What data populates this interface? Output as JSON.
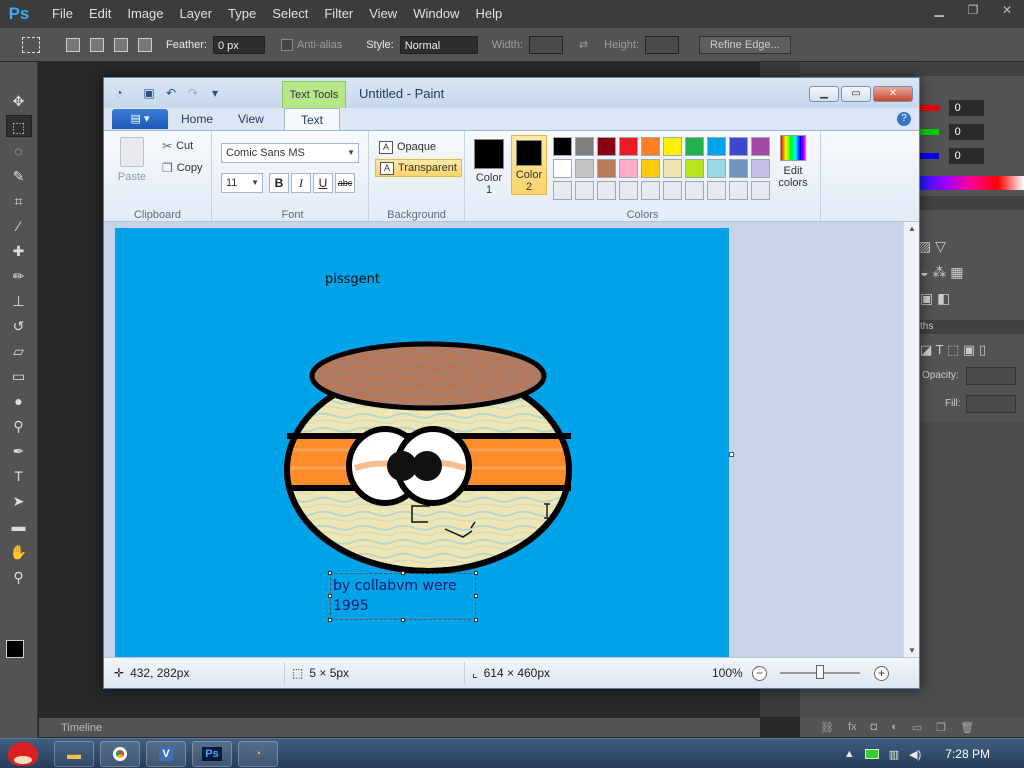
{
  "photoshop": {
    "logo": "Ps",
    "menu": [
      "File",
      "Edit",
      "Image",
      "Layer",
      "Type",
      "Select",
      "Filter",
      "View",
      "Window",
      "Help"
    ],
    "options": {
      "feather_label": "Feather:",
      "feather_value": "0 px",
      "antialias_label": "Anti-alias",
      "style_label": "Style:",
      "style_value": "Normal",
      "width_label": "Width:",
      "height_label": "Height:",
      "refine_edge": "Refine Edge..."
    },
    "color_panel": {
      "r": "0",
      "g": "0",
      "b": "0"
    },
    "panel_labels": {
      "paths": "ths",
      "opacity": "Opacity:",
      "fill": "Fill:"
    },
    "timeline": "Timeline"
  },
  "paint": {
    "context_tab": "Text Tools",
    "title": "Untitled - Paint",
    "tabs": [
      "Home",
      "View",
      "Text"
    ],
    "active_tab": "Text",
    "clipboard": {
      "paste": "Paste",
      "cut": "Cut",
      "copy": "Copy",
      "group": "Clipboard"
    },
    "font": {
      "family": "Comic Sans MS",
      "size": "11",
      "bold": "B",
      "italic": "I",
      "underline": "U",
      "strike": "abc",
      "group": "Font"
    },
    "background": {
      "opaque": "Opaque",
      "transparent": "Transparent",
      "group": "Background",
      "selected": "Transparent"
    },
    "colors": {
      "color1_label": "Color\n1",
      "color2_label": "Color\n2",
      "color1": "#000000",
      "color2": "#000000",
      "edit_colors": "Edit\ncolors",
      "group": "Colors",
      "palette_row1": [
        "#000000",
        "#7f7f7f",
        "#880015",
        "#ed1c24",
        "#ff7f27",
        "#fff200",
        "#22b14c",
        "#00a2e8",
        "#3f48cc",
        "#a349a4"
      ],
      "palette_row2": [
        "#ffffff",
        "#c3c3c3",
        "#b97a57",
        "#ffaec9",
        "#ffc90e",
        "#efe4b0",
        "#b5e61d",
        "#99d9ea",
        "#7092be",
        "#c8bfe7"
      ],
      "palette_row3": [
        "#e6ebf2",
        "#e6ebf2",
        "#e6ebf2",
        "#e6ebf2",
        "#e6ebf2",
        "#e6ebf2",
        "#e6ebf2",
        "#e6ebf2",
        "#e6ebf2",
        "#e6ebf2"
      ]
    },
    "canvas": {
      "background": "#00a2e8",
      "caption": "pissgent",
      "text_box": "by collabvm were\n1995"
    },
    "status": {
      "cursor": "432, 282px",
      "selection": "5 × 5px",
      "image_size": "614 × 460px",
      "zoom": "100%"
    }
  },
  "taskbar": {
    "apps": [
      "Explorer",
      "Chrome",
      "VirtualBox",
      "Photoshop",
      "Paint"
    ],
    "clock": "7:28 PM"
  }
}
